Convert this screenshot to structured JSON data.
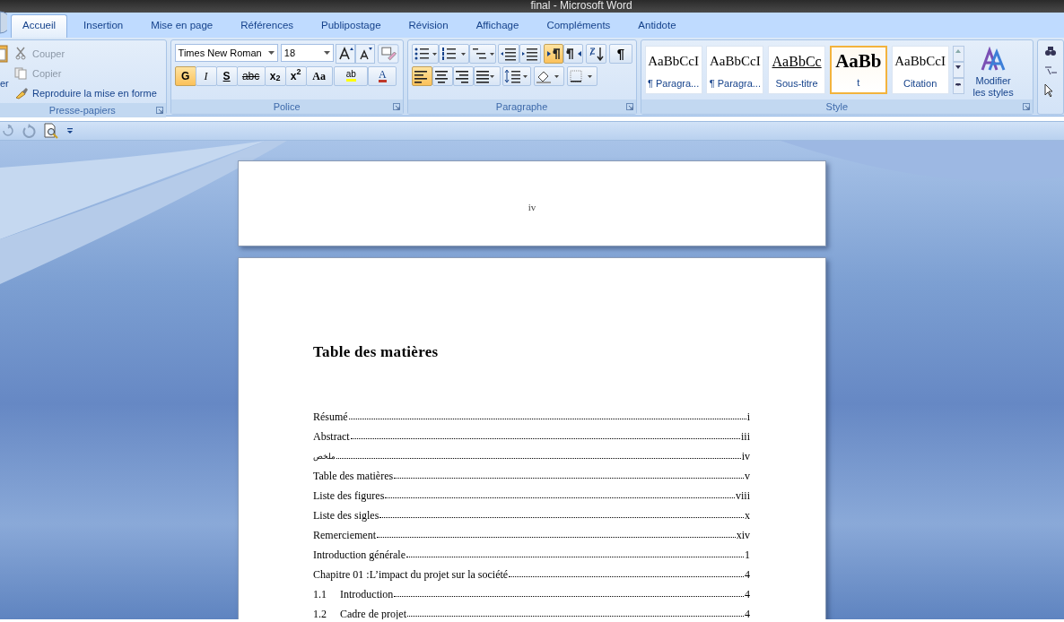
{
  "window": {
    "title": "final - Microsoft Word"
  },
  "tabs": [
    {
      "label": "Accueil",
      "selected": true
    },
    {
      "label": "Insertion",
      "selected": false
    },
    {
      "label": "Mise en page",
      "selected": false
    },
    {
      "label": "Références",
      "selected": false
    },
    {
      "label": "Publipostage",
      "selected": false
    },
    {
      "label": "Révision",
      "selected": false
    },
    {
      "label": "Affichage",
      "selected": false
    },
    {
      "label": "Compléments",
      "selected": false
    },
    {
      "label": "Antidote",
      "selected": false
    }
  ],
  "clipboard": {
    "label": "Presse-papiers",
    "paste_label": "er",
    "actions": [
      {
        "kind": "cut",
        "label": "Couper",
        "disabled": true
      },
      {
        "kind": "copy",
        "label": "Copier",
        "disabled": true
      },
      {
        "kind": "brush",
        "label": "Reproduire la mise en forme",
        "disabled": false
      }
    ]
  },
  "font": {
    "label": "Police",
    "font_name": "Times New Roman",
    "font_size": "18",
    "format_buttons": [
      {
        "kind": "bold",
        "text": "G",
        "selected": true
      },
      {
        "kind": "italic",
        "text": "I",
        "selected": false
      },
      {
        "kind": "underline",
        "text": "S",
        "selected": false
      },
      {
        "kind": "strike",
        "text": "abc",
        "selected": false
      },
      {
        "kind": "script",
        "text": "x$_{2}$",
        "selected": false
      },
      {
        "kind": "script",
        "text": "x$^{2}$",
        "selected": false
      },
      {
        "kind": "case",
        "text": "Aa",
        "selected": false
      }
    ],
    "highlight_text": "ab",
    "color_text": "A"
  },
  "paragraph": {
    "label": "Paragraphe",
    "show_marks": "¶",
    "buttons": [
      {
        "kind": "ltr",
        "selected": true
      },
      {
        "kind": "rtl",
        "selected": false
      }
    ],
    "alignments": [
      {
        "kind": "left",
        "selected": true
      },
      {
        "kind": "center",
        "selected": false
      },
      {
        "kind": "right",
        "selected": false
      },
      {
        "kind": "justify",
        "selected": false
      }
    ]
  },
  "styles": {
    "label": "Style",
    "modify": "Modifier les styles",
    "items": [
      {
        "preview": "AaBbCcI",
        "name": "¶ Paragra...",
        "selected": false,
        "kind": "normal"
      },
      {
        "preview": "AaBbCcI",
        "name": "¶ Paragra...",
        "selected": false,
        "kind": "normal"
      },
      {
        "preview": "AaBbCc",
        "name": "Sous-titre",
        "selected": false,
        "kind": "underline"
      },
      {
        "preview": "AaBb",
        "name": "t",
        "selected": true,
        "kind": "title"
      },
      {
        "preview": "AaBbCcI",
        "name": "Citation",
        "selected": false,
        "kind": "normal"
      }
    ]
  },
  "document": {
    "previous_page_number": "iv",
    "heading": "Table des matières",
    "toc": [
      {
        "title": "Résumé",
        "page": "i"
      },
      {
        "title": "Abstract",
        "page": "iii"
      },
      {
        "title": "ملخص",
        "page": "iv"
      },
      {
        "title": "Table des matières",
        "page": "v"
      },
      {
        "title": "Liste des figures",
        "page": "viii"
      },
      {
        "title": "Liste des sigles",
        "page": "x"
      },
      {
        "title": "Remerciement",
        "page": "xiv"
      },
      {
        "title": "Introduction générale",
        "page": "1"
      },
      {
        "title": "Chapitre 01 :L’impact du projet sur la société",
        "page": "4"
      },
      {
        "number": "1.1",
        "title": "Introduction",
        "page": "4"
      },
      {
        "number": "1.2",
        "title": "Cadre de projet",
        "page": "4"
      }
    ]
  }
}
